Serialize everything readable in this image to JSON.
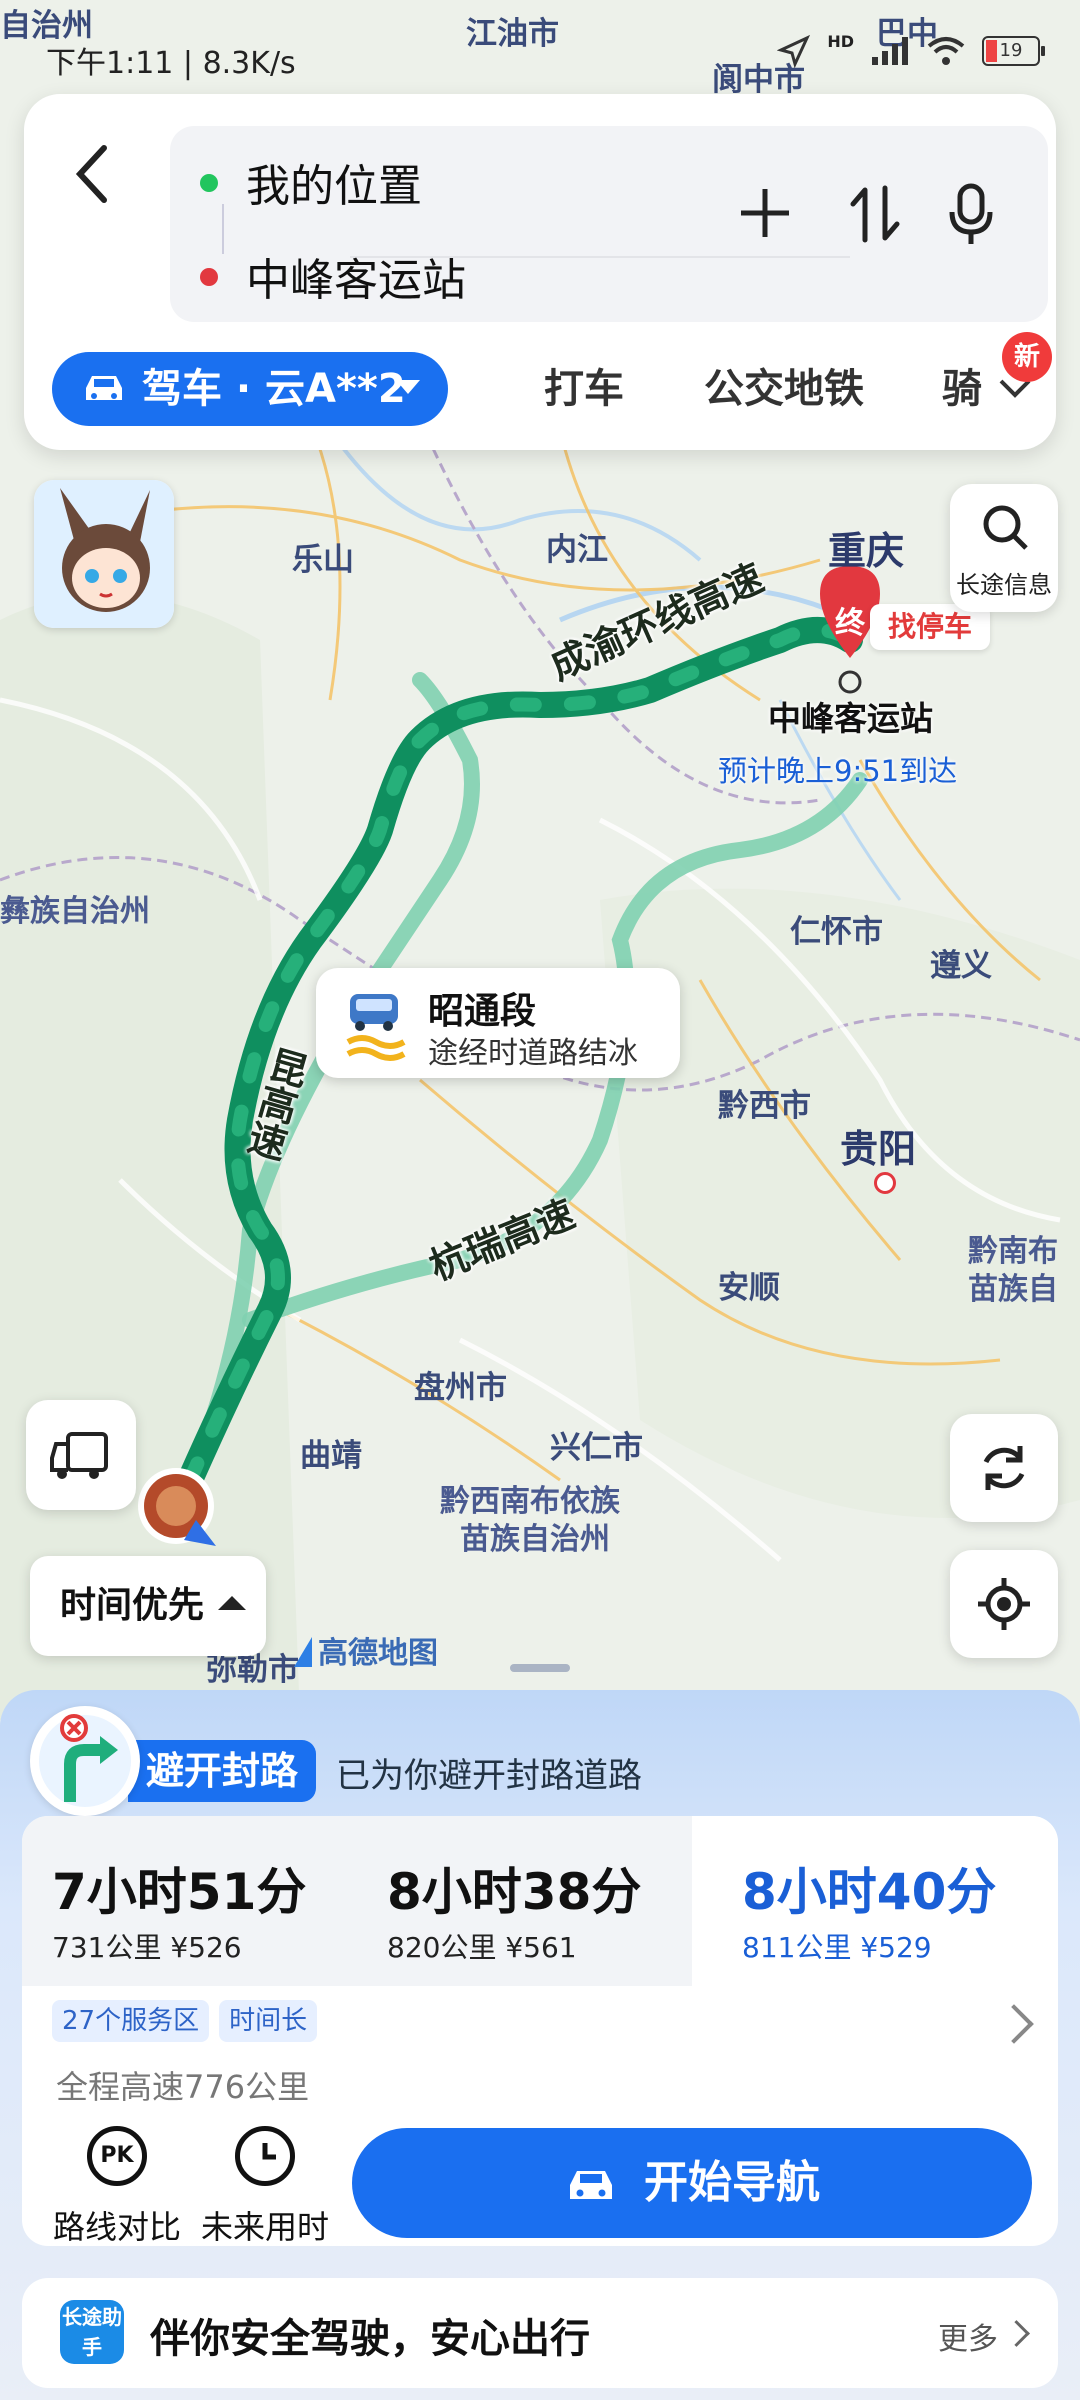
{
  "status_bar": {
    "time": "下午1:11",
    "net_speed": "8.3K/s",
    "hd_label": "HD",
    "battery_level": "19"
  },
  "search": {
    "origin": "我的位置",
    "destination": "中峰客运站"
  },
  "modes": {
    "active": "驾车 · 云A**2",
    "tabs": [
      "打车",
      "公交地铁",
      "骑"
    ],
    "new_badge": "新"
  },
  "map": {
    "places": {
      "jiangyou": "江油市",
      "langzhong": "阆中市",
      "bazhong": "巴中",
      "leshan": "乐山",
      "neijiang": "内江",
      "chongqing": "重庆",
      "renhuai": "仁怀市",
      "zunyi": "遵义",
      "qianxi": "黔西市",
      "guiyang": "贵阳",
      "anshun": "安顺",
      "qiannan1": "黔南布",
      "qiannan2": "苗族自",
      "panzhou": "盘州市",
      "xingren": "兴仁市",
      "qianxinan1": "黔西南布依族",
      "qianxinan2": "苗族自治州",
      "qujing": "曲靖",
      "yizu": "彝族自治州",
      "zizhizhou": "自治州",
      "mile": "弥勒市"
    },
    "highways": {
      "chengyu": "成渝环线高速",
      "hangrui": "杭瑞高速",
      "yunkun": "昆高速"
    },
    "destination_label": "中峰客运站",
    "end_marker": "终",
    "eta": "预计晚上9:51到达",
    "parking": "找停车",
    "long_trip_info": "长途信息",
    "ice_title": "昭通段",
    "ice_desc": "途经时道路结冰",
    "preference": "时间优先",
    "logo_text": "高德地图"
  },
  "notice": {
    "badge": "避开封路",
    "message": "已为你避开封路道路"
  },
  "routes": [
    {
      "duration": "7小时51分",
      "distance": "731公里",
      "cost": "¥526"
    },
    {
      "duration": "8小时38分",
      "distance": "820公里",
      "cost": "¥561"
    },
    {
      "duration": "8小时40分",
      "distance": "811公里",
      "cost": "¥529"
    }
  ],
  "selected_route_index": 2,
  "route_tags": [
    "27个服务区",
    "时间长"
  ],
  "highway_summary": "全程高速776公里",
  "actions": {
    "compare": "路线对比",
    "compare_icon": "PK",
    "future": "未来用时",
    "start": "开始导航"
  },
  "assistant": {
    "logo": "长途助手",
    "text": "伴你安全驾驶，安心出行",
    "more": "更多"
  },
  "colors": {
    "accent": "#1a70f0",
    "route_selected": "#139463",
    "route_alt": "#6cc8a4",
    "destination_red": "#e2383f"
  }
}
